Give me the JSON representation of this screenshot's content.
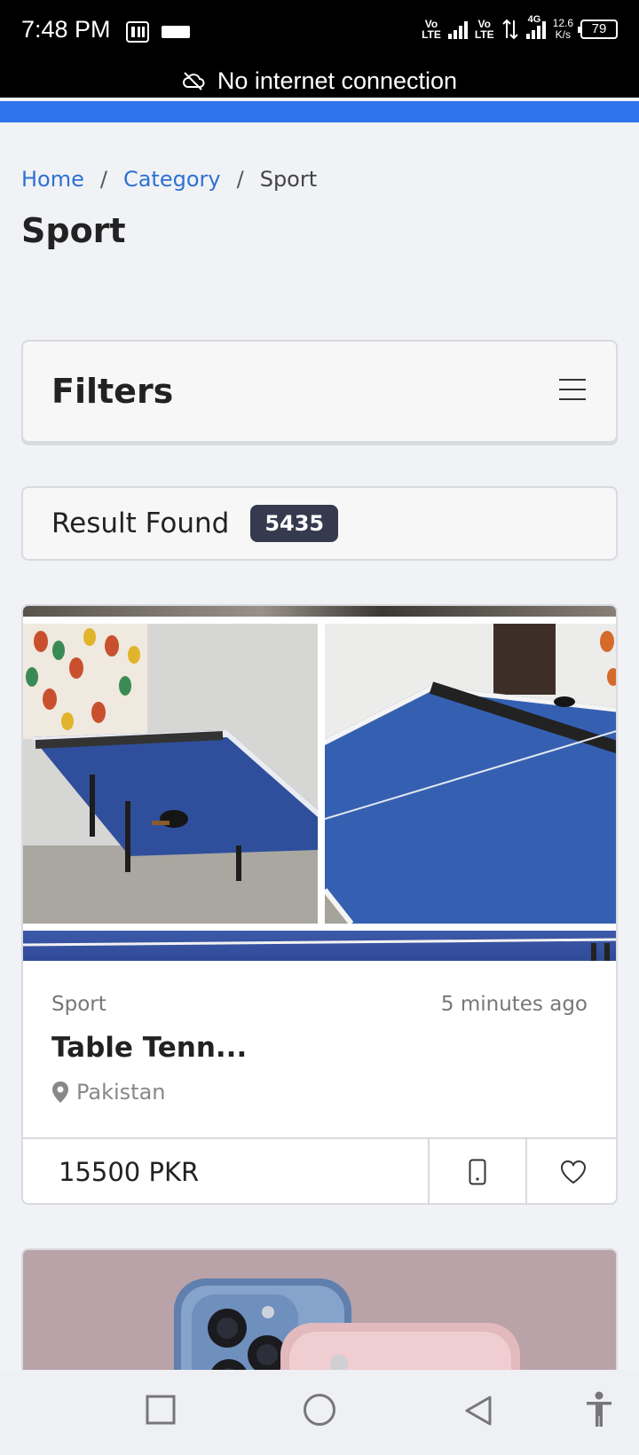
{
  "status_bar": {
    "time": "7:48 PM",
    "volte1": "Vo\nLTE",
    "volte2": "Vo\nLTE",
    "net_type": "4G",
    "speed_value": "12.6",
    "speed_unit": "K/s",
    "battery": "79",
    "icons": [
      "paytm-icon",
      "screen-record-icon",
      "signal-icon",
      "data-arrows-icon",
      "battery-icon"
    ]
  },
  "offline_banner": {
    "text": "No internet connection",
    "icon": "cloud-off-icon"
  },
  "colors": {
    "accent": "#2f74ea",
    "link": "#2d72d2",
    "badge": "#353a4e"
  },
  "breadcrumb": {
    "items": [
      {
        "label": "Home"
      },
      {
        "label": "Category"
      },
      {
        "label": "Sport"
      }
    ],
    "separator": "/"
  },
  "page_title": "Sport",
  "filters": {
    "title": "Filters",
    "icon": "hamburger-menu-icon"
  },
  "results": {
    "label": "Result Found",
    "count": "5435"
  },
  "listings": [
    {
      "category": "Sport",
      "time_ago": "5 minutes ago",
      "title": "Table Tenn...",
      "location": "Pakistan",
      "price": "15500 PKR",
      "actions": [
        "phone-icon",
        "heart-icon"
      ]
    }
  ],
  "nav_bar": {
    "buttons": [
      "recents-square-icon",
      "home-circle-icon",
      "back-triangle-icon",
      "accessibility-icon"
    ]
  }
}
